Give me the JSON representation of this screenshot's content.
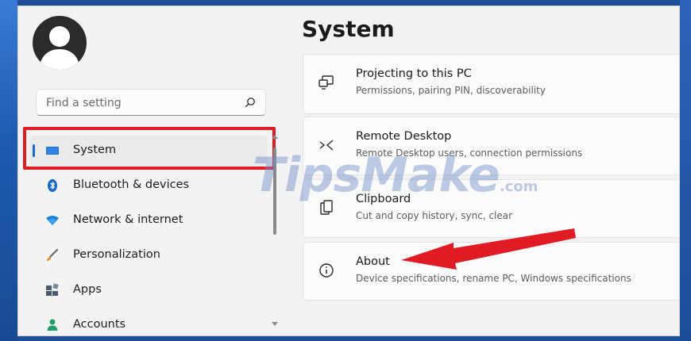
{
  "colors": {
    "accent": "#1668c9",
    "highlight": "#e01b24",
    "wallpaper": "#1f4e96"
  },
  "search": {
    "placeholder": "Find a setting",
    "icon": "search-icon"
  },
  "sidebar": {
    "items": [
      {
        "label": "System",
        "icon": "monitor-icon",
        "selected": true
      },
      {
        "label": "Bluetooth & devices",
        "icon": "bluetooth-icon"
      },
      {
        "label": "Network & internet",
        "icon": "wifi-icon"
      },
      {
        "label": "Personalization",
        "icon": "brush-icon"
      },
      {
        "label": "Apps",
        "icon": "apps-icon"
      },
      {
        "label": "Accounts",
        "icon": "person-icon"
      }
    ]
  },
  "main": {
    "title": "System",
    "cards": [
      {
        "title": "Projecting to this PC",
        "desc": "Permissions, pairing PIN, discoverability",
        "icon": "projector-icon"
      },
      {
        "title": "Remote Desktop",
        "desc": "Remote Desktop users, connection permissions",
        "icon": "remote-desktop-icon"
      },
      {
        "title": "Clipboard",
        "desc": "Cut and copy history, sync, clear",
        "icon": "clipboard-icon"
      },
      {
        "title": "About",
        "desc": "Device specifications, rename PC, Windows specifications",
        "icon": "info-icon"
      }
    ]
  },
  "watermark": {
    "text": "TipsMake",
    "suffix": ".com"
  }
}
